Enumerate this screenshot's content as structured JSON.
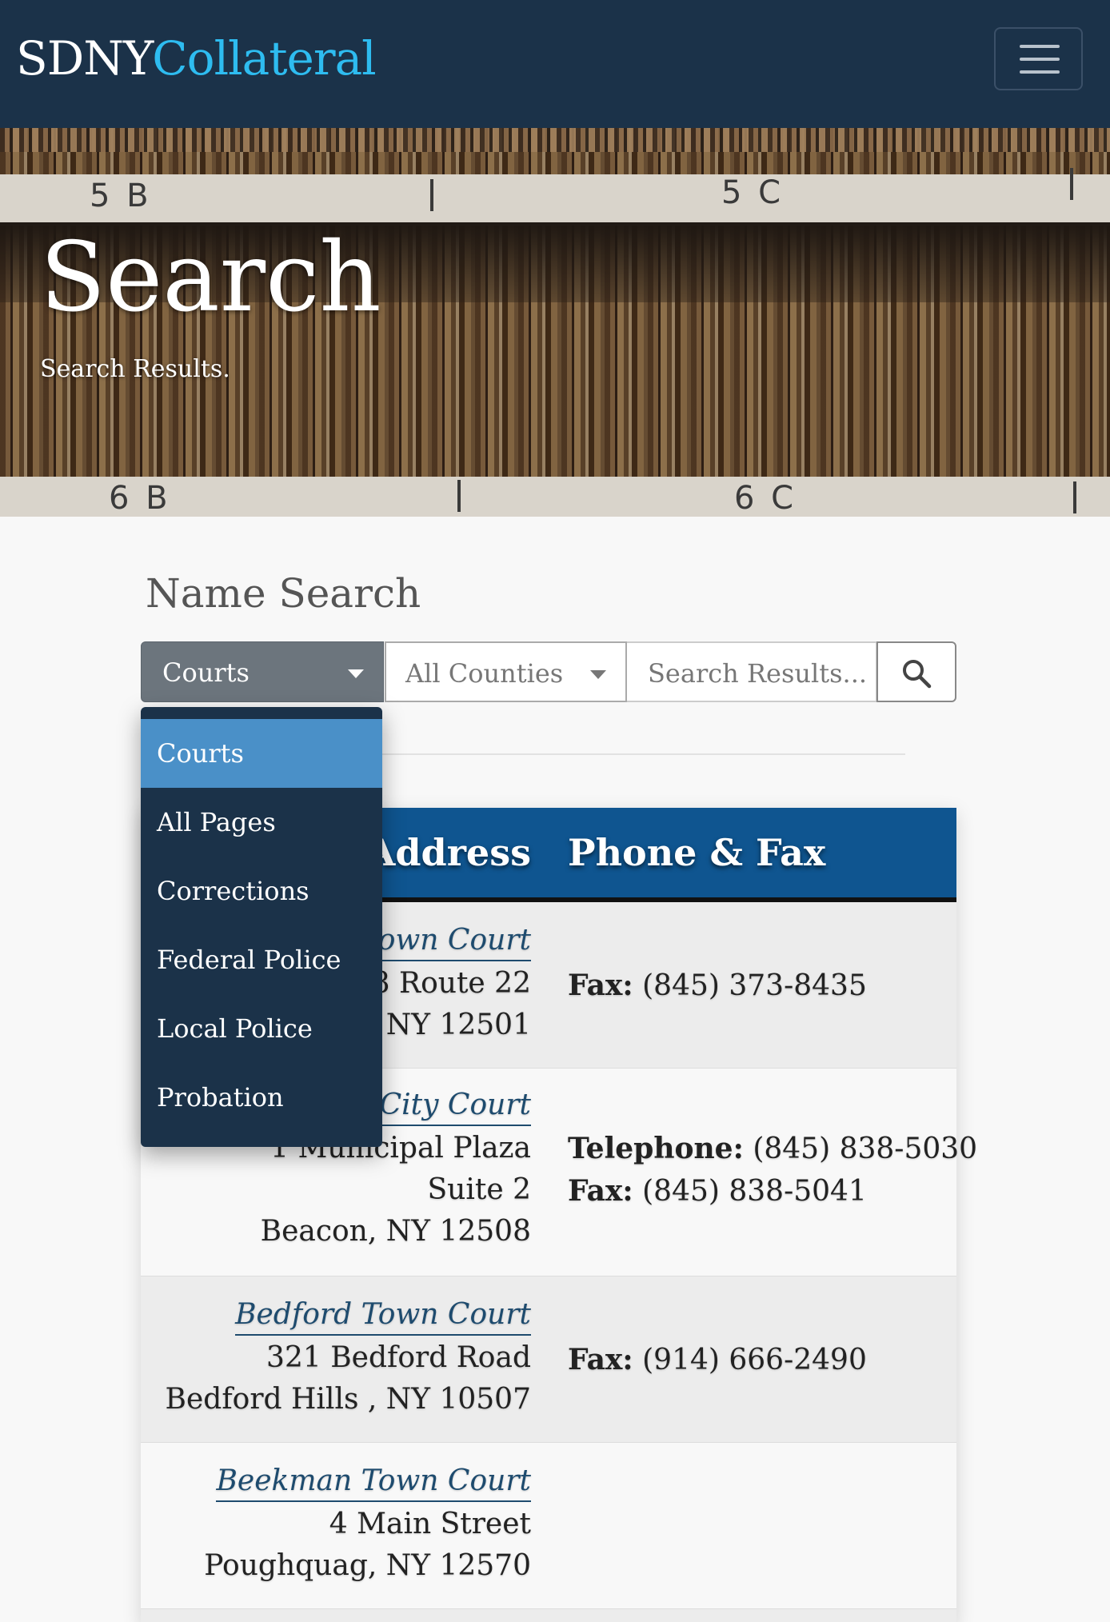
{
  "navbar": {
    "brand_primary": "SDNY",
    "brand_accent": "Collateral",
    "menu_icon": "hamburger-menu-icon"
  },
  "hero": {
    "title": "Search",
    "subtitle": "Search Results.",
    "shelf_labels": [
      "5 B",
      "5 C",
      "6 B",
      "6 C"
    ]
  },
  "search": {
    "section_title": "Name Search",
    "type_select_value": "Courts",
    "county_select_value": "All Counties",
    "input_placeholder": "Search Results...",
    "button_icon": "search-icon"
  },
  "dropdown": {
    "items": [
      {
        "label": "Courts",
        "active": true
      },
      {
        "label": "All Pages",
        "active": false
      },
      {
        "label": "Corrections",
        "active": false
      },
      {
        "label": "Federal Police",
        "active": false
      },
      {
        "label": "Local Police",
        "active": false
      },
      {
        "label": "Probation",
        "active": false
      }
    ]
  },
  "table": {
    "headers": {
      "address": "Address",
      "phone": "Phone & Fax"
    },
    "rows": [
      {
        "name": "Town Court",
        "address_lines": [
          "88 Route 22",
          "a, NY 12501"
        ],
        "phone_lines": [
          {
            "label": "Fax:",
            "value": " (845) 373-8435"
          }
        ]
      },
      {
        "name": "City Court",
        "address_lines": [
          "1 Municipal Plaza",
          "Suite 2",
          "Beacon, NY 12508"
        ],
        "phone_lines": [
          {
            "label": "Telephone:",
            "value": " (845) 838-5030"
          },
          {
            "label": "Fax:",
            "value": " (845) 838-5041"
          }
        ]
      },
      {
        "name": "Bedford Town Court",
        "address_lines": [
          "321 Bedford Road",
          "Bedford Hills , NY 10507"
        ],
        "phone_lines": [
          {
            "label": "Fax:",
            "value": " (914) 666-2490"
          }
        ]
      },
      {
        "name": "Beekman Town Court",
        "address_lines": [
          "4 Main Street",
          "Poughquag, NY 12570"
        ],
        "phone_lines": []
      }
    ]
  },
  "colors": {
    "navbar_bg": "#1b3249",
    "brand_accent": "#2ebcf0",
    "table_header_bg": "#0f5590",
    "dropdown_active": "#4a90c8",
    "link": "#1e4b6e"
  }
}
